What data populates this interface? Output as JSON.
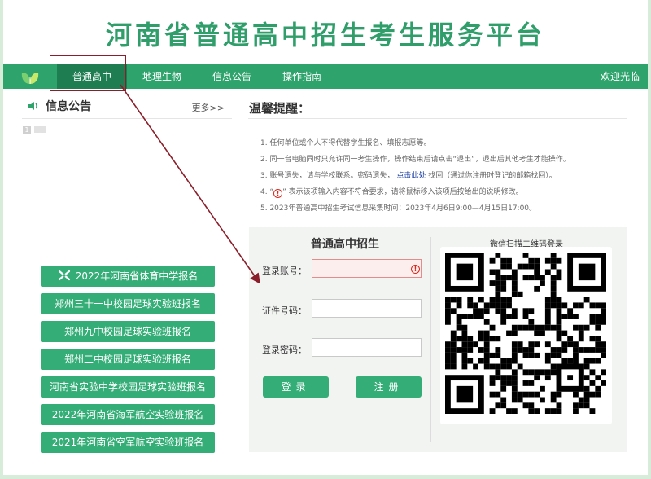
{
  "site_title": "河南省普通高中招生考生服务平台",
  "nav": {
    "items": [
      {
        "label": "普通高中",
        "active": true
      },
      {
        "label": "地理生物",
        "active": false
      },
      {
        "label": "信息公告",
        "active": false
      },
      {
        "label": "操作指南",
        "active": false
      }
    ],
    "welcome": "欢迎光临"
  },
  "news": {
    "title": "信息公告",
    "more": "更多>>",
    "items": [
      {
        "num": "1"
      }
    ]
  },
  "registration_buttons": [
    {
      "label": "2022年河南省体育中学报名",
      "icon": "sports-icon"
    },
    {
      "label": "郑州三十一中校园足球实验班报名"
    },
    {
      "label": "郑州九中校园足球实验班报名"
    },
    {
      "label": "郑州二中校园足球实验班报名"
    },
    {
      "label": "河南省实验中学校园足球实验班报名"
    },
    {
      "label": "2022年河南省海军航空实验班报名"
    },
    {
      "label": "2021年河南省空军航空实验班报名"
    }
  ],
  "reminder": {
    "title": "温馨提醒：",
    "n1": "1. 任何单位或个人不得代替学生报名、填报志愿等。",
    "n2": "2. 同一台电脑同时只允许同一考生操作，操作结束后请点击“退出”，退出后其他考生才能操作。",
    "n3_pre": "3. 账号遗失，请与学校联系。密码遗失，",
    "n3_link": "点击此处",
    "n3_post": "找回（通过你注册时登记的邮箱找回）。",
    "n4_pre": "4. “",
    "n4_icon": "!",
    "n4_post": "” 表示该项输入内容不符合要求，请将鼠标移入该项后按给出的说明修改。",
    "n5": "5. 2023年普通高中招生考试信息采集时间：2023年4月6日9:00—4月15日17:00。"
  },
  "login": {
    "heading": "普通高中招生",
    "account_label": "登录账号：",
    "account_value": "",
    "id_label": "证件号码：",
    "id_value": "",
    "password_label": "登录密码：",
    "password_value": "",
    "error_icon": "!",
    "login_button": "登录",
    "register_button": "注册",
    "qr_heading": "微信扫描二维码登录"
  },
  "colors": {
    "brand_green": "#2ea36c",
    "nav_active": "#1f7d52",
    "button_green": "#34ad77",
    "title_green": "#2f9e6a",
    "annotation": "#8a1f2b",
    "error_red": "#d9281c",
    "link_blue": "#1b3fa6"
  }
}
